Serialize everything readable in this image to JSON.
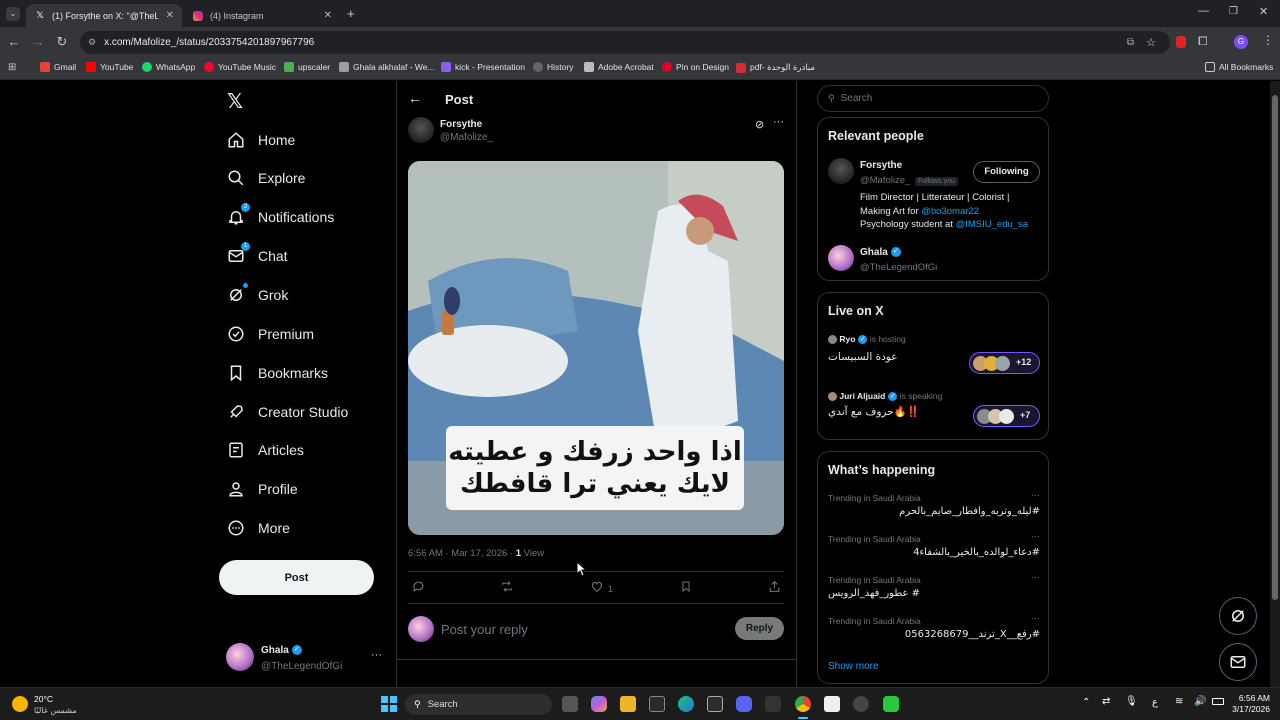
{
  "browser": {
    "tabs": [
      {
        "title": "(1) Forsythe on X: \"@TheLege",
        "active": true
      },
      {
        "title": "(4) Instagram",
        "active": false
      }
    ],
    "url": "x.com/Mafolize_/status/2033754201897967796",
    "bookmarks": [
      "Gmail",
      "YouTube",
      "WhatsApp",
      "YouTube Music",
      "upscaler",
      "Ghala alkhalaf - We...",
      "kick - Presentation",
      "History",
      "Adobe Acrobat",
      "Pin on Design",
      "pdf- مبادرة الوحدة"
    ],
    "all_bookmarks": "All Bookmarks"
  },
  "sidebar": {
    "items": [
      {
        "label": "Home",
        "icon": "home-icon"
      },
      {
        "label": "Explore",
        "icon": "search-icon"
      },
      {
        "label": "Notifications",
        "icon": "bell-icon",
        "badge": "2"
      },
      {
        "label": "Chat",
        "icon": "mail-icon",
        "badge": "1"
      },
      {
        "label": "Grok",
        "icon": "grok-icon"
      },
      {
        "label": "Premium",
        "icon": "premium-icon"
      },
      {
        "label": "Bookmarks",
        "icon": "bookmark-icon"
      },
      {
        "label": "Creator Studio",
        "icon": "rocket-icon"
      },
      {
        "label": "Articles",
        "icon": "article-icon"
      },
      {
        "label": "Profile",
        "icon": "person-icon"
      },
      {
        "label": "More",
        "icon": "more-icon"
      }
    ],
    "post_button": "Post",
    "account": {
      "name": "Ghala",
      "handle": "@TheLegendOfGi"
    }
  },
  "post": {
    "header": "Post",
    "author": {
      "name": "Forsythe",
      "handle": "@Mafolize_"
    },
    "image_caption_line1": "اذا واحد زرفك و عطيته",
    "image_caption_line2": "لايك يعني ترا قافطك",
    "timestamp": "6:56 AM · Mar 17, 2026 · ",
    "views_count": "1",
    "views_label": "View",
    "like_count": "1",
    "reply_placeholder": "Post your reply",
    "reply_button": "Reply"
  },
  "right": {
    "search_placeholder": "Search",
    "relevant": {
      "title": "Relevant people",
      "person1": {
        "name": "Forsythe",
        "handle": "@Mafolize_",
        "follows_you": "Follows you",
        "button": "Following",
        "bio_line1": "Film Director | Litterateur | Colorist |",
        "bio_line2_prefix": "Making Art for ",
        "bio_line2_link": "@bo3omar22",
        "bio_line3_prefix": "Psychology student at ",
        "bio_line3_link": "@IMSIU_edu_sa"
      },
      "person2": {
        "name": "Ghala",
        "handle": "@TheLegendOfGi"
      }
    },
    "live": {
      "title": "Live on X",
      "items": [
        {
          "host": "Ryo",
          "status": "is hosting",
          "title": "عودة السبيسات",
          "count": "+12"
        },
        {
          "host": "Juri Aljuaid",
          "status": "is speaking",
          "title": "حروف مع آندي🔥‼️",
          "count": "+7"
        }
      ]
    },
    "happening": {
      "title": "What’s happening",
      "items": [
        {
          "context": "Trending in Saudi Arabia",
          "topic": "#ليله_وتربه_وافطار_صايم_بالحرم"
        },
        {
          "context": "Trending in Saudi Arabia",
          "topic": "#دعاء_لوالده_بالخير_بالشفاء4"
        },
        {
          "context": "Trending in Saudi Arabia",
          "topic": "# عطور_فهد_الرويس"
        },
        {
          "context": "Trending in Saudi Arabia",
          "topic": "#رفع__X_ترند__0563268679"
        }
      ],
      "show_more": "Show more"
    }
  },
  "taskbar": {
    "weather_temp": "20°C",
    "weather_desc": "مشمس غالبًا",
    "search": "Search",
    "lang": "ع",
    "time": "6:56 AM",
    "date": "3/17/2026"
  },
  "colors": {
    "accent": "#1d9bf0",
    "bg": "#000000",
    "border": "#2f3336"
  }
}
